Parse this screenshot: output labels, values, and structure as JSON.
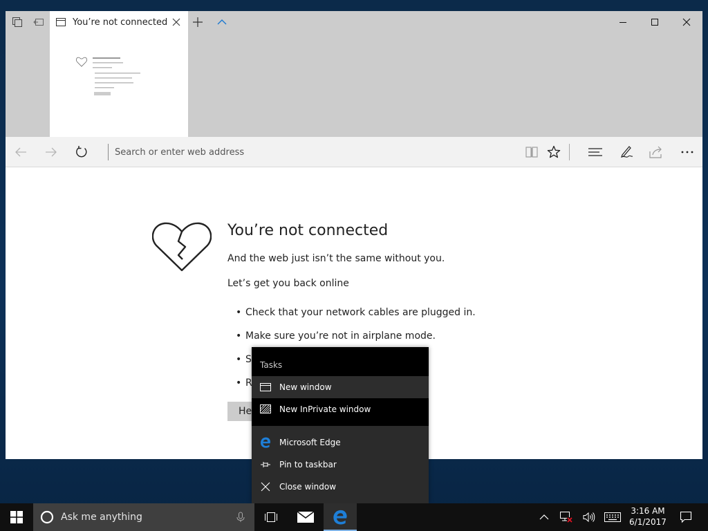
{
  "tabbar": {
    "active_tab_title": "You’re not connected"
  },
  "navbar": {
    "address_placeholder": "Search or enter web address"
  },
  "error_page": {
    "title": "You’re not connected",
    "subtitle": "And the web just isn’t the same without you.",
    "lead": "Let’s get you back online",
    "bullets": [
      "Check that your network cables are plugged in.",
      "Make sure you’re not in airplane mode.",
      "S",
      "R"
    ],
    "help_button_label": "He"
  },
  "jumplist": {
    "header": "Tasks",
    "tasks": [
      {
        "label": "New window",
        "icon": "window-icon"
      },
      {
        "label": "New InPrivate window",
        "icon": "inprivate-icon"
      }
    ],
    "items": [
      {
        "label": "Microsoft Edge",
        "icon": "edge-icon"
      },
      {
        "label": "Pin to taskbar",
        "icon": "pin-icon"
      },
      {
        "label": "Close window",
        "icon": "close-icon"
      }
    ]
  },
  "taskbar": {
    "search_placeholder": "Ask me anything",
    "clock_time": "3:16 AM",
    "clock_date": "6/1/2017"
  },
  "colors": {
    "edge_blue": "#0f6fd0",
    "taskbar": "#101010",
    "jumplist_bg": "#2b2b2b",
    "chrome_gray": "#cccccc"
  }
}
